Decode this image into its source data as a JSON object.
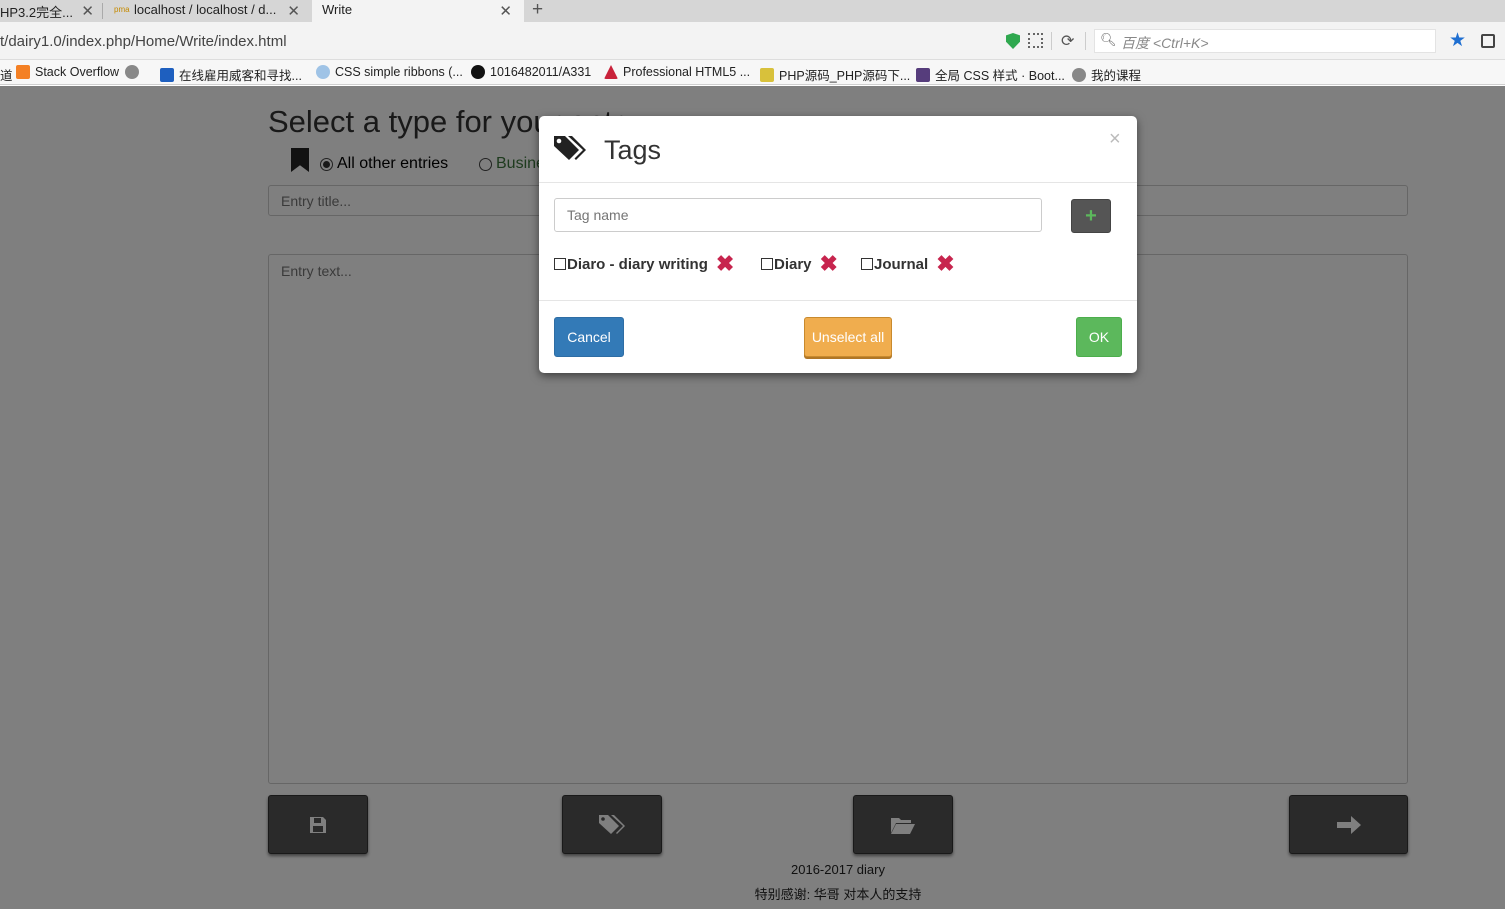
{
  "browser": {
    "tabs": [
      {
        "label": "HP3.2完全..."
      },
      {
        "label": "localhost / localhost / d..."
      },
      {
        "label": "Write"
      }
    ],
    "new_tab_label": "+",
    "url": "t/dairy1.0/index.php/Home/Write/index.html",
    "search_placeholder": "百度 <Ctrl+K>",
    "bookmarks": [
      {
        "label": "道"
      },
      {
        "label": "Stack Overflow"
      },
      {
        "label": "在线雇用威客和寻找..."
      },
      {
        "label": "CSS simple ribbons (..."
      },
      {
        "label": "1016482011/A331"
      },
      {
        "label": "Professional HTML5 ..."
      },
      {
        "label": "PHP源码_PHP源码下..."
      },
      {
        "label": "全局 CSS 样式 · Boot..."
      },
      {
        "label": "我的课程"
      }
    ]
  },
  "page": {
    "heading": "Select a type for your entry",
    "types": [
      {
        "label": "All other entries",
        "selected": true
      },
      {
        "label": "Business",
        "selected": false
      }
    ],
    "title_placeholder": "Entry title...",
    "text_placeholder": "Entry text...",
    "footer_year": "2016-2017 diary",
    "footer_thanks": "特别感谢: 华哥 对本人的支持"
  },
  "modal": {
    "title": "Tags",
    "close_label": "×",
    "tag_name_placeholder": "Tag name",
    "add_label": "+",
    "tags": [
      {
        "label": "Diaro - diary writing",
        "checked": false
      },
      {
        "label": "Diary",
        "checked": false
      },
      {
        "label": "Journal",
        "checked": false
      }
    ],
    "delete_label": "✖",
    "cancel_label": "Cancel",
    "unselect_label": "Unselect all",
    "ok_label": "OK"
  },
  "colors": {
    "primary": "#337ab7",
    "warning": "#f0ad4e",
    "success": "#5cb85c",
    "danger": "#c7254e",
    "dark_button": "#555555"
  }
}
